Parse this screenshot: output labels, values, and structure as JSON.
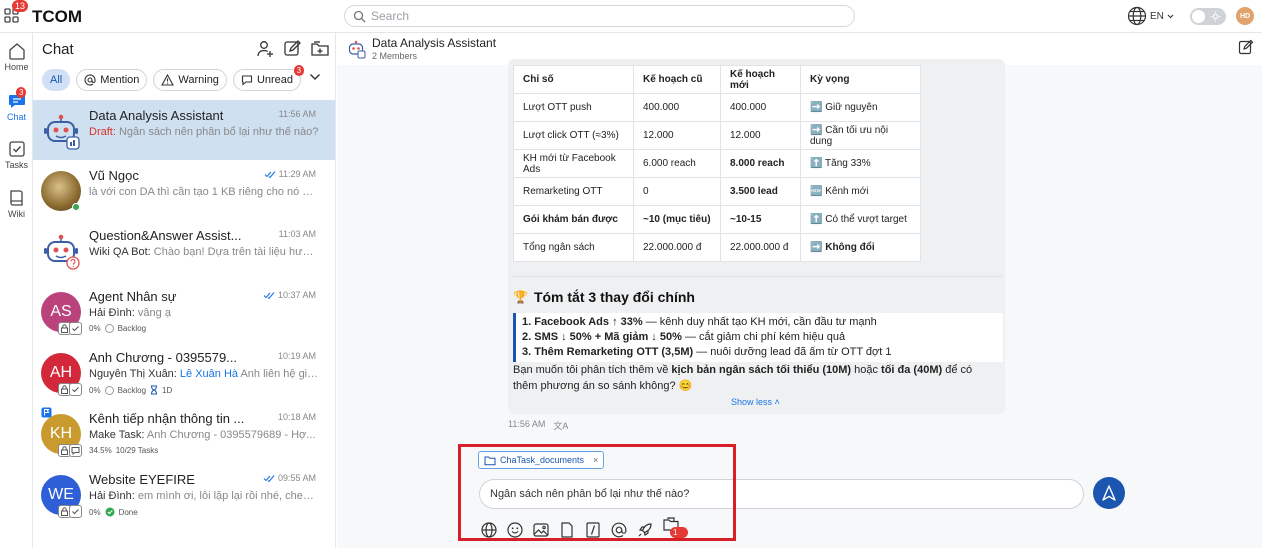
{
  "app": {
    "name": "TCOM",
    "apps_badge": "13"
  },
  "search": {
    "placeholder": "Search"
  },
  "topbar": {
    "language": "EN",
    "user_initials": "HD"
  },
  "rail": [
    {
      "label": "Home",
      "icon": "home-icon"
    },
    {
      "label": "Chat",
      "icon": "chat-icon",
      "badge": "3"
    },
    {
      "label": "Tasks",
      "icon": "tasks-icon"
    },
    {
      "label": "Wiki",
      "icon": "wiki-icon"
    }
  ],
  "chatlist": {
    "title": "Chat",
    "filters": [
      {
        "label": "All"
      },
      {
        "label": "Mention",
        "icon": "at-icon"
      },
      {
        "label": "Warning",
        "icon": "warning-icon"
      },
      {
        "label": "Unread",
        "icon": "unread-icon",
        "badge": "3"
      }
    ],
    "conversations": [
      {
        "name": "Data Analysis Assistant",
        "time": "11:56 AM",
        "draft": "Draft:",
        "preview": " Ngân sách nên phân bổ lại như thế nào?"
      },
      {
        "name": "Vũ Ngọc",
        "time": "11:29 AM",
        "preview": "là với con DA thì cần tạo 1 KB riêng cho nó hay ..."
      },
      {
        "name": "Question&Answer Assist...",
        "time": "11:03 AM",
        "who": "Wiki QA Bot:",
        "preview": " Chào bạn! Dựa trên tài liệu hướn..."
      },
      {
        "name": "Agent Nhân sự",
        "time": "10:37 AM",
        "initials": "AS",
        "who": "Hải Đình:",
        "preview": " vâng ạ",
        "meta": "0%",
        "status": "Backlog"
      },
      {
        "name": "Anh Chương - 0395579...",
        "time": "10:19 AM",
        "initials": "AH",
        "who": "Nguyễn Thị Xuân:",
        "mention": " Lê Xuân Hà",
        "preview": " Anh liên hệ giú...",
        "meta": "0%",
        "status": "Backlog",
        "due": "1D"
      },
      {
        "name": "Kênh tiếp nhận thông tin ...",
        "time": "10:18 AM",
        "initials": "KH",
        "who": "Make Task:",
        "preview": " Anh Chương - 0395579689 - Hợ...",
        "meta": "34.5%",
        "status": "10/29 Tasks"
      },
      {
        "name": "Website EYEFIRE",
        "time": "09:55 AM",
        "initials": "WE",
        "who": "Hải Đình:",
        "preview": " em mình ơi, lỗi lặp lại rồi nhé, check g...",
        "meta": "0%",
        "status": "Done"
      }
    ]
  },
  "header": {
    "title": "Data Analysis Assistant",
    "members": "2 Members"
  },
  "table": {
    "headers": [
      "Chỉ số",
      "Kế hoạch cũ",
      "Kế hoạch mới",
      "Kỳ vọng"
    ],
    "rows": [
      [
        "Lượt OTT push",
        "400.000",
        "400.000",
        "➡️ Giữ nguyên"
      ],
      [
        "Lượt click OTT (≈3%)",
        "12.000",
        "12.000",
        "➡️ Cần tối ưu nội dung"
      ],
      [
        "KH mới từ Facebook Ads",
        "6.000 reach",
        "8.000 reach",
        "⬆️ Tăng 33%"
      ],
      [
        "Remarketing OTT",
        "0",
        "3.500 lead",
        "🆕 Kênh mới"
      ],
      [
        "Gói khám bán được",
        "~10 (mục tiêu)",
        "~10-15",
        "⬆️ Có thể vượt target"
      ],
      [
        "Tổng ngân sách",
        "22.000.000 đ",
        "22.000.000 đ",
        "➡️ Không đổi"
      ]
    ]
  },
  "summary": {
    "emoji": "🏆",
    "title": "Tóm tắt 3 thay đổi chính",
    "items": [
      {
        "bold": "1. Facebook Ads ↑ 33%",
        "rest": " — kênh duy nhất tạo KH mới, cần đầu tư mạnh"
      },
      {
        "bold": "2. SMS ↓ 50% + Mã giảm ↓ 50%",
        "rest": " — cắt giảm chi phí kém hiệu quả"
      },
      {
        "bold": "3. Thêm Remarketing OTT (3,5M)",
        "rest": " — nuôi dưỡng lead đã ấm từ OTT đợt 1"
      }
    ],
    "followup_a": "Bạn muốn tôi phân tích thêm về ",
    "followup_b": "kịch bản ngân sách tối thiểu (10M)",
    "followup_c": " hoặc ",
    "followup_d": "tối đa (40M)",
    "followup_e": " để có thêm phương án so sánh không? 😊",
    "show_less": "Show less",
    "time": "11:56 AM",
    "translate_glyph": "文A"
  },
  "composer": {
    "attachment": "ChaTask_documents",
    "remove": "×",
    "text": "Ngân sách nên phân bổ lại như thế nào?",
    "tool_badge": "1"
  },
  "colors": {
    "accent": "#1a56b0",
    "highlight": "#d61f26",
    "badge": "#e53935"
  }
}
